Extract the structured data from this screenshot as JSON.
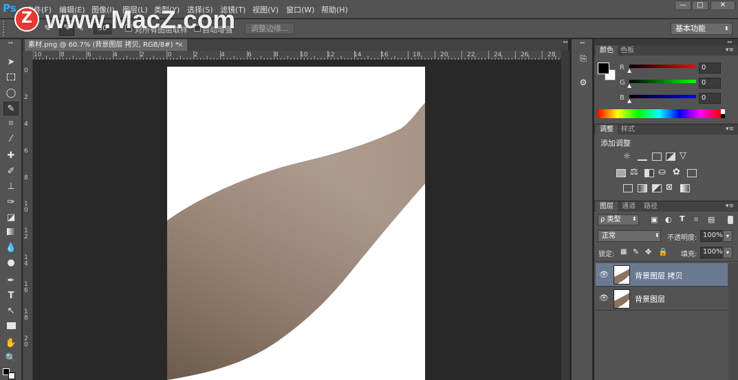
{
  "app": {
    "logo": "Ps",
    "menu": [
      "文件(F)",
      "编辑(E)",
      "图像(I)",
      "图层(L)",
      "类型(Y)",
      "选择(S)",
      "滤镜(T)",
      "视图(V)",
      "窗口(W)",
      "帮助(H)"
    ],
    "window_controls": [
      "—",
      "□",
      "✕"
    ]
  },
  "watermark": {
    "letter": "Z",
    "text": "www.MacZ.com"
  },
  "options": {
    "brush_size": "30",
    "sample_all_layers": "对所有图层取样",
    "auto_enhance": "自动增强",
    "refine_edge": "调整边缘...",
    "workspace": "基本功能"
  },
  "document": {
    "tab_title": "素材.png @ 60.7% (背景图层 拷贝, RGB/8#) *",
    "close": "×",
    "hruler_ticks": [
      "10",
      "8",
      "6",
      "4",
      "2",
      "0",
      "2",
      "4",
      "6",
      "8",
      "10",
      "12",
      "14",
      "16",
      "18",
      "20",
      "22",
      "24",
      "26",
      "28"
    ],
    "vruler_ticks": [
      "0",
      "2",
      "4",
      "6",
      "8",
      "1\n0",
      "1\n2",
      "1\n4",
      "1\n6",
      "1\n8",
      "2\n0"
    ]
  },
  "color_panel": {
    "tabs": [
      "颜色",
      "色板"
    ],
    "channels": [
      {
        "label": "R",
        "value": "0"
      },
      {
        "label": "G",
        "value": "0"
      },
      {
        "label": "B",
        "value": "0"
      }
    ]
  },
  "adjust_panel": {
    "tabs": [
      "调整",
      "样式"
    ],
    "title": "添加调整"
  },
  "layers_panel": {
    "tabs": [
      "图层",
      "通道",
      "路径"
    ],
    "filter": "ρ 类型",
    "blend_mode": "正常",
    "opacity_label": "不透明度:",
    "opacity": "100%",
    "lock_label": "锁定:",
    "fill_label": "填充:",
    "fill": "100%",
    "layers": [
      {
        "name": "背景图层 拷贝",
        "selected": true
      },
      {
        "name": "背景图层",
        "selected": false
      }
    ]
  },
  "colors": {
    "ui_dark": "#535353",
    "canvas_bg": "#282828",
    "selected_layer": "#6a7a93",
    "skin": "#9c8675"
  }
}
